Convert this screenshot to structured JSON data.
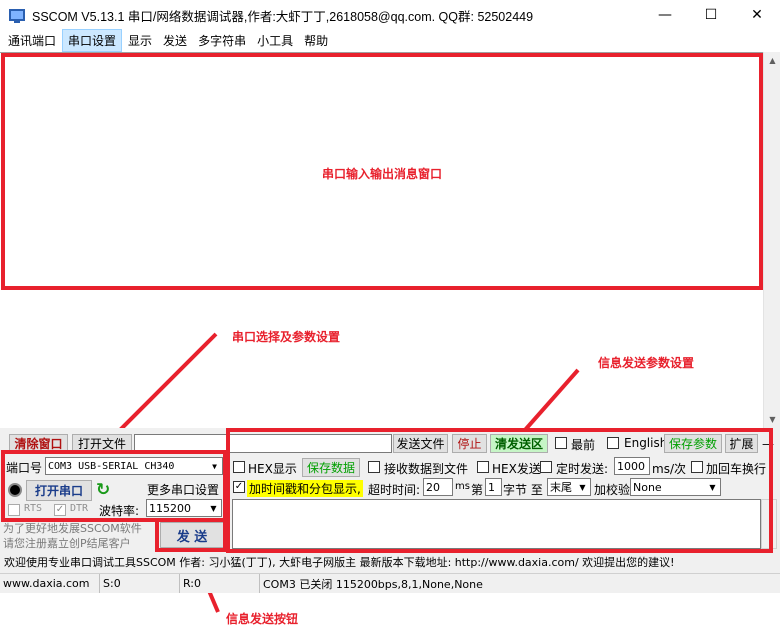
{
  "window": {
    "title": "SSCOM V5.13.1 串口/网络数据调试器,作者:大虾丁丁,2618058@qq.com. QQ群:  52502449",
    "minimize": "—",
    "maximize": "☐",
    "close": "✕"
  },
  "menu": [
    "通讯端口",
    "串口设置",
    "显示",
    "发送",
    "多字符串",
    "小工具",
    "帮助"
  ],
  "annotations": {
    "receive_window": "串口输入输出消息窗口",
    "port_settings": "串口选择及参数设置",
    "send_settings": "信息发送参数设置",
    "send_button": "信息发送按钮"
  },
  "toolbar": {
    "clear_window": "清除窗口",
    "open_file": "打开文件",
    "send_file": "发送文件",
    "stop": "停止",
    "clear_send_area": "清发送区",
    "topmost": "最前",
    "english": "English",
    "save_params": "保存参数",
    "expand": "扩展",
    "collapse": "—"
  },
  "port": {
    "port_label": "端口号",
    "port_value": "COM3 USB-SERIAL CH340",
    "open_port": "打开串口",
    "more_settings": "更多串口设置",
    "rts": "RTS",
    "dtr": "DTR",
    "baud_label": "波特率:",
    "baud_value": "115200"
  },
  "options": {
    "hex_display": "HEX显示",
    "save_data": "保存数据",
    "recv_to_file": "接收数据到文件",
    "hex_send": "HEX发送",
    "timed_send": "定时发送:",
    "interval": "1000",
    "interval_unit": "ms/次",
    "add_crlf": "加回车换行",
    "timestamp": "加时间戳和分包显示,",
    "timeout_label": "超时时间:",
    "timeout_value": "20",
    "timeout_unit": "ms",
    "byte_label": "第",
    "byte_value": "1",
    "byte_unit": "字节 至",
    "end_value": "末尾",
    "checksum_label": "加校验",
    "checksum_value": "None"
  },
  "promo": [
    "为了更好地发展SSCOM软件",
    "请您注册嘉立创P结尾客户"
  ],
  "send_button": "发  送",
  "ticker": "欢迎使用专业串口调试工具SSCOM    作者: 习小猛(丁丁), 大虾电子网版主  最新版本下载地址: http://www.daxia.com/ 欢迎提出您的建议!",
  "status": {
    "website": "www.daxia.com",
    "sent": "S:0",
    "received": "R:0",
    "port_state": "COM3 已关闭  115200bps,8,1,None,None"
  },
  "colors": {
    "annotation_red": "#e8212d",
    "highlight_yellow": "#ffff00",
    "save_green": "#00a000",
    "clear_send_green": "#c6f5c6"
  }
}
